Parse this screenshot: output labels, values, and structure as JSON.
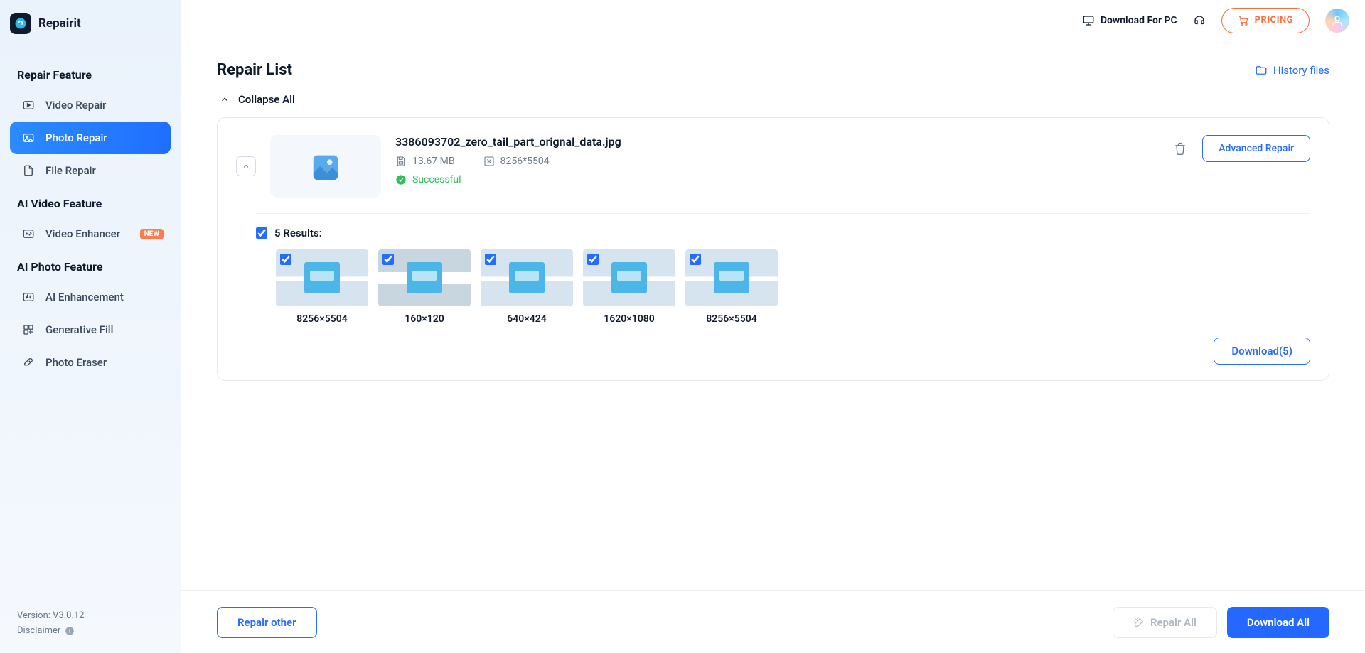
{
  "app": {
    "name": "Repairit"
  },
  "sidebar": {
    "sections": [
      {
        "title": "Repair Feature",
        "items": [
          {
            "label": "Video Repair"
          },
          {
            "label": "Photo Repair"
          },
          {
            "label": "File Repair"
          }
        ]
      },
      {
        "title": "AI Video Feature",
        "items": [
          {
            "label": "Video Enhancer",
            "badge": "NEW"
          }
        ]
      },
      {
        "title": "AI Photo Feature",
        "items": [
          {
            "label": "AI Enhancement"
          },
          {
            "label": "Generative Fill"
          },
          {
            "label": "Photo Eraser"
          }
        ]
      }
    ],
    "version": "Version: V3.0.12",
    "disclaimer": "Disclaimer"
  },
  "topbar": {
    "download_pc": "Download For PC",
    "pricing": "PRICING"
  },
  "page": {
    "title": "Repair List",
    "history": "History files",
    "collapse": "Collapse All"
  },
  "file": {
    "name": "3386093702_zero_tail_part_orignal_data.jpg",
    "size": "13.67 MB",
    "dimensions": "8256*5504",
    "status": "Successful",
    "advanced": "Advanced Repair"
  },
  "results": {
    "label": "5 Results:",
    "items": [
      {
        "dim": "8256×5504"
      },
      {
        "dim": "160×120"
      },
      {
        "dim": "640×424"
      },
      {
        "dim": "1620×1080"
      },
      {
        "dim": "8256×5504"
      }
    ],
    "download": "Download(5)"
  },
  "footer": {
    "repair_other": "Repair other",
    "repair_all": "Repair All",
    "download_all": "Download All"
  }
}
